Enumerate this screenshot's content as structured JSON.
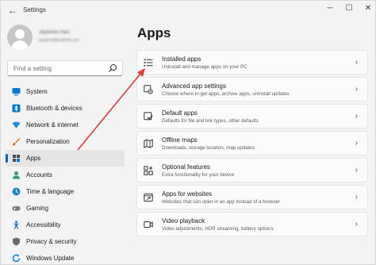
{
  "window": {
    "title": "Settings",
    "controls": {
      "minimize": "─",
      "maximize": "☐",
      "close": "✕"
    }
  },
  "profile": {
    "name": "Jayasree Paul",
    "email": "jayasree@outlook.com"
  },
  "search": {
    "placeholder": "Find a setting"
  },
  "sidebar": {
    "items": [
      {
        "label": "System",
        "icon": "system-icon",
        "color": "#0078d4"
      },
      {
        "label": "Bluetooth & devices",
        "icon": "bluetooth-icon",
        "color": "#0078d4"
      },
      {
        "label": "Network & internet",
        "icon": "network-icon",
        "color": "#1e8bd6"
      },
      {
        "label": "Personalization",
        "icon": "brush-icon",
        "color": "#e07a1f"
      },
      {
        "label": "Apps",
        "icon": "apps-icon",
        "color": "#444a58",
        "selected": true
      },
      {
        "label": "Accounts",
        "icon": "accounts-icon",
        "color": "#2e9e6a"
      },
      {
        "label": "Time & language",
        "icon": "time-language-icon",
        "color": "#1f88c9"
      },
      {
        "label": "Gaming",
        "icon": "gaming-icon",
        "color": "#7a7a7a"
      },
      {
        "label": "Accessibility",
        "icon": "accessibility-icon",
        "color": "#1f6fc1"
      },
      {
        "label": "Privacy & security",
        "icon": "shield-icon",
        "color": "#6b6b6b"
      },
      {
        "label": "Windows Update",
        "icon": "windows-update-icon",
        "color": "#1e8bd6"
      }
    ]
  },
  "main": {
    "title": "Apps",
    "cards": [
      {
        "title": "Installed apps",
        "desc": "Uninstall and manage apps on your PC",
        "icon": "installed-apps-icon"
      },
      {
        "title": "Advanced app settings",
        "desc": "Choose where to get apps, archive apps, uninstall updates",
        "icon": "advanced-app-settings-icon"
      },
      {
        "title": "Default apps",
        "desc": "Defaults for file and link types, other defaults",
        "icon": "default-apps-icon"
      },
      {
        "title": "Offline maps",
        "desc": "Downloads, storage location, map updates",
        "icon": "offline-maps-icon"
      },
      {
        "title": "Optional features",
        "desc": "Extra functionality for your device",
        "icon": "optional-features-icon"
      },
      {
        "title": "Apps for websites",
        "desc": "Websites that can open in an app instead of a browser",
        "icon": "apps-for-websites-icon"
      },
      {
        "title": "Video playback",
        "desc": "Video adjustments, HDR streaming, battery options",
        "icon": "video-playback-icon"
      }
    ]
  },
  "annotation": {
    "arrow_color": "#e03a3a"
  }
}
